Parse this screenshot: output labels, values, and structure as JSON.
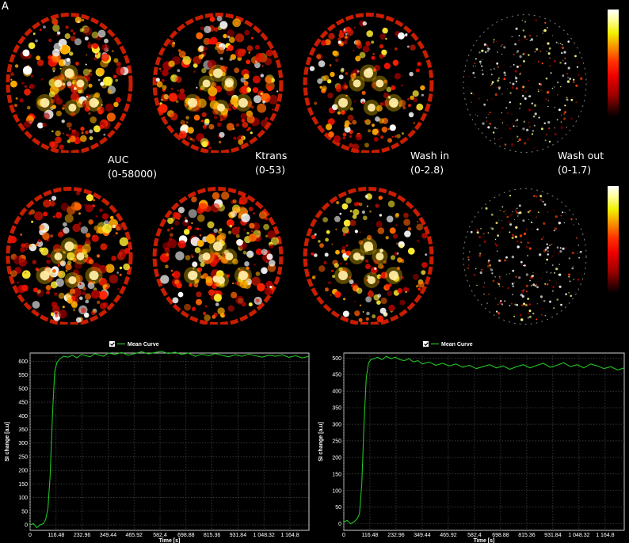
{
  "panel_label": "A",
  "maps": [
    {
      "name": "AUC",
      "range": "(0-58000)"
    },
    {
      "name": "Ktrans",
      "range": "(0-53)"
    },
    {
      "name": "Wash in",
      "range": "(0-2.8)"
    },
    {
      "name": "Wash out",
      "range": "(0-1.7)"
    }
  ],
  "colors": {
    "background": "#000000",
    "curve": "#22c422",
    "grid": "#5a5a5a",
    "axis": "#cfcfcf"
  },
  "chart_data": [
    {
      "type": "line",
      "legend": "Mean Curve",
      "xlabel": "Time [s]",
      "ylabel": "SI change [a.u]",
      "xlim": [
        0,
        1250
      ],
      "ylim": [
        -20,
        630
      ],
      "xticks": [
        "0",
        "116.48",
        "232.96",
        "349.44",
        "465.92",
        "582.4",
        "698.88",
        "815.36",
        "931.84",
        "1 048.32",
        "1 164.8"
      ],
      "xtick_values": [
        0,
        116.48,
        232.96,
        349.44,
        465.92,
        582.4,
        698.88,
        815.36,
        931.84,
        1048.32,
        1164.8
      ],
      "yticks": [
        0,
        50,
        100,
        150,
        200,
        250,
        300,
        350,
        400,
        450,
        500,
        550,
        600
      ],
      "grid": true,
      "series": [
        {
          "name": "Mean Curve",
          "x": [
            0,
            15,
            30,
            45,
            60,
            70,
            80,
            90,
            100,
            110,
            120,
            135,
            150,
            170,
            190,
            210,
            230,
            250,
            270,
            290,
            310,
            330,
            350,
            380,
            410,
            440,
            470,
            500,
            530,
            560,
            590,
            620,
            650,
            680,
            710,
            740,
            770,
            800,
            830,
            860,
            890,
            920,
            950,
            980,
            1010,
            1040,
            1070,
            1100,
            1130,
            1160,
            1190,
            1220,
            1250
          ],
          "values": [
            0,
            5,
            -10,
            0,
            5,
            20,
            60,
            180,
            400,
            560,
            595,
            610,
            618,
            615,
            622,
            612,
            625,
            620,
            616,
            628,
            622,
            618,
            630,
            625,
            632,
            622,
            628,
            635,
            627,
            632,
            636,
            628,
            633,
            625,
            630,
            618,
            626,
            620,
            628,
            622,
            616,
            624,
            618,
            626,
            620,
            615,
            622,
            618,
            624,
            614,
            620,
            612,
            618
          ]
        }
      ]
    },
    {
      "type": "line",
      "legend": "Mean Curve",
      "xlabel": "Time [s]",
      "ylabel": "SI change [a.u]",
      "xlim": [
        0,
        1250
      ],
      "ylim": [
        -20,
        515
      ],
      "xticks": [
        "0",
        "116.48",
        "232.96",
        "349.44",
        "465.92",
        "582.4",
        "698.88",
        "815.36",
        "931.84",
        "1 048.32",
        "1 164.8"
      ],
      "xtick_values": [
        0,
        116.48,
        232.96,
        349.44,
        465.92,
        582.4,
        698.88,
        815.36,
        931.84,
        1048.32,
        1164.8
      ],
      "yticks": [
        0,
        50,
        100,
        150,
        200,
        250,
        300,
        350,
        400,
        450,
        500
      ],
      "grid": true,
      "series": [
        {
          "name": "Mean Curve",
          "x": [
            0,
            15,
            30,
            45,
            60,
            70,
            80,
            90,
            100,
            110,
            120,
            135,
            150,
            170,
            190,
            210,
            230,
            250,
            270,
            290,
            310,
            330,
            350,
            380,
            410,
            440,
            470,
            500,
            530,
            560,
            590,
            620,
            650,
            680,
            710,
            740,
            770,
            800,
            830,
            860,
            890,
            920,
            950,
            980,
            1010,
            1040,
            1070,
            1100,
            1130,
            1160,
            1190,
            1220,
            1250
          ],
          "values": [
            5,
            10,
            0,
            5,
            15,
            30,
            120,
            300,
            440,
            485,
            495,
            498,
            502,
            495,
            505,
            498,
            502,
            495,
            492,
            498,
            488,
            492,
            482,
            488,
            478,
            484,
            476,
            482,
            472,
            478,
            468,
            474,
            480,
            470,
            476,
            466,
            474,
            480,
            470,
            478,
            484,
            472,
            478,
            486,
            474,
            480,
            470,
            482,
            476,
            468,
            474,
            464,
            470
          ]
        }
      ]
    }
  ]
}
